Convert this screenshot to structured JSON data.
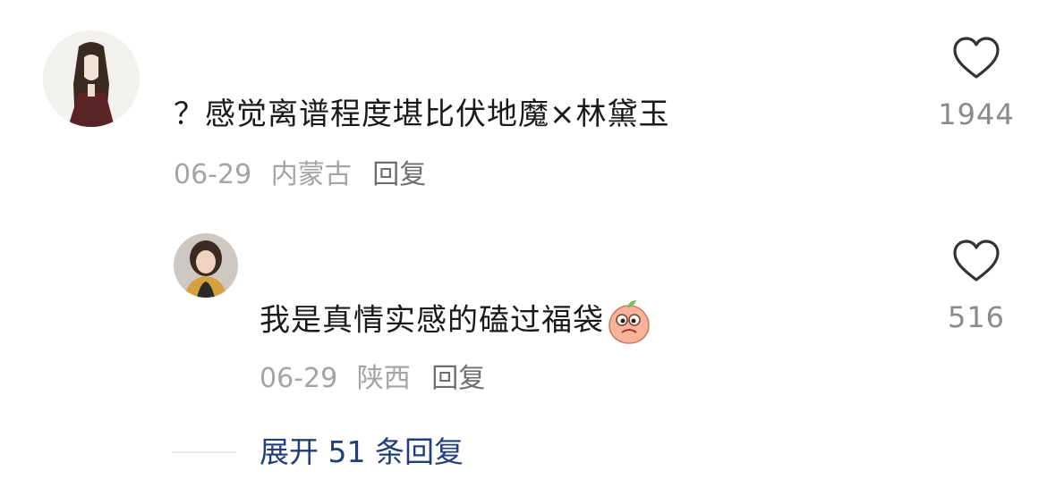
{
  "comments": [
    {
      "text": "？感觉离谱程度堪比伏地魔×林黛玉",
      "date": "06-29",
      "location": "内蒙古",
      "reply_label": "回复",
      "likes": "1944"
    }
  ],
  "replies": [
    {
      "text": "我是真情实感的磕过福袋",
      "emoji": "peach-face-emoji",
      "date": "06-29",
      "location": "陕西",
      "reply_label": "回复",
      "likes": "516"
    }
  ],
  "expand": {
    "label": "展开 51 条回复"
  },
  "colors": {
    "text": "#1a1a1a",
    "meta": "#a4a4a4",
    "link": "#203f7a",
    "emoji": "#f7b39b"
  }
}
